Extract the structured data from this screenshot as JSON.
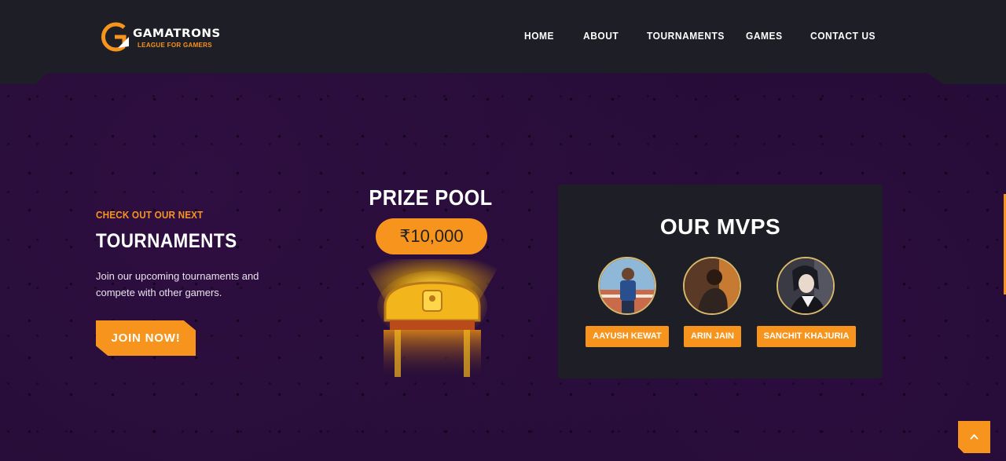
{
  "header": {
    "logo": {
      "name": "GAMATRONS",
      "tagline": "LEAGUE FOR GAMERS",
      "icon": "g-arrow-logo-icon"
    },
    "nav": [
      {
        "label": "HOME"
      },
      {
        "label": "ABOUT"
      },
      {
        "label": "TOURNAMENTS"
      },
      {
        "label": "GAMES"
      },
      {
        "label": "CONTACT US"
      }
    ]
  },
  "intro": {
    "kicker": "CHECK OUT OUR NEXT",
    "heading": "TOURNAMENTS",
    "description": "Join our upcoming tournaments and compete with other gamers.",
    "button_label": "JOIN NOW!"
  },
  "prize": {
    "title": "PRIZE POOL",
    "amount": "₹10,000",
    "icon": "treasure-chest-icon"
  },
  "mvps": {
    "title": "OUR MVPS",
    "players": [
      {
        "name": "AAYUSH KEWAT"
      },
      {
        "name": "ARIN JAIN"
      },
      {
        "name": "SANCHIT KHAJURIA"
      }
    ]
  },
  "colors": {
    "accent": "#f7941d",
    "header_bg": "#1e1e26",
    "page_bg": "#230c34",
    "card_bg": "#1e1e26"
  },
  "scroll_top": {
    "icon": "chevron-up-icon"
  }
}
